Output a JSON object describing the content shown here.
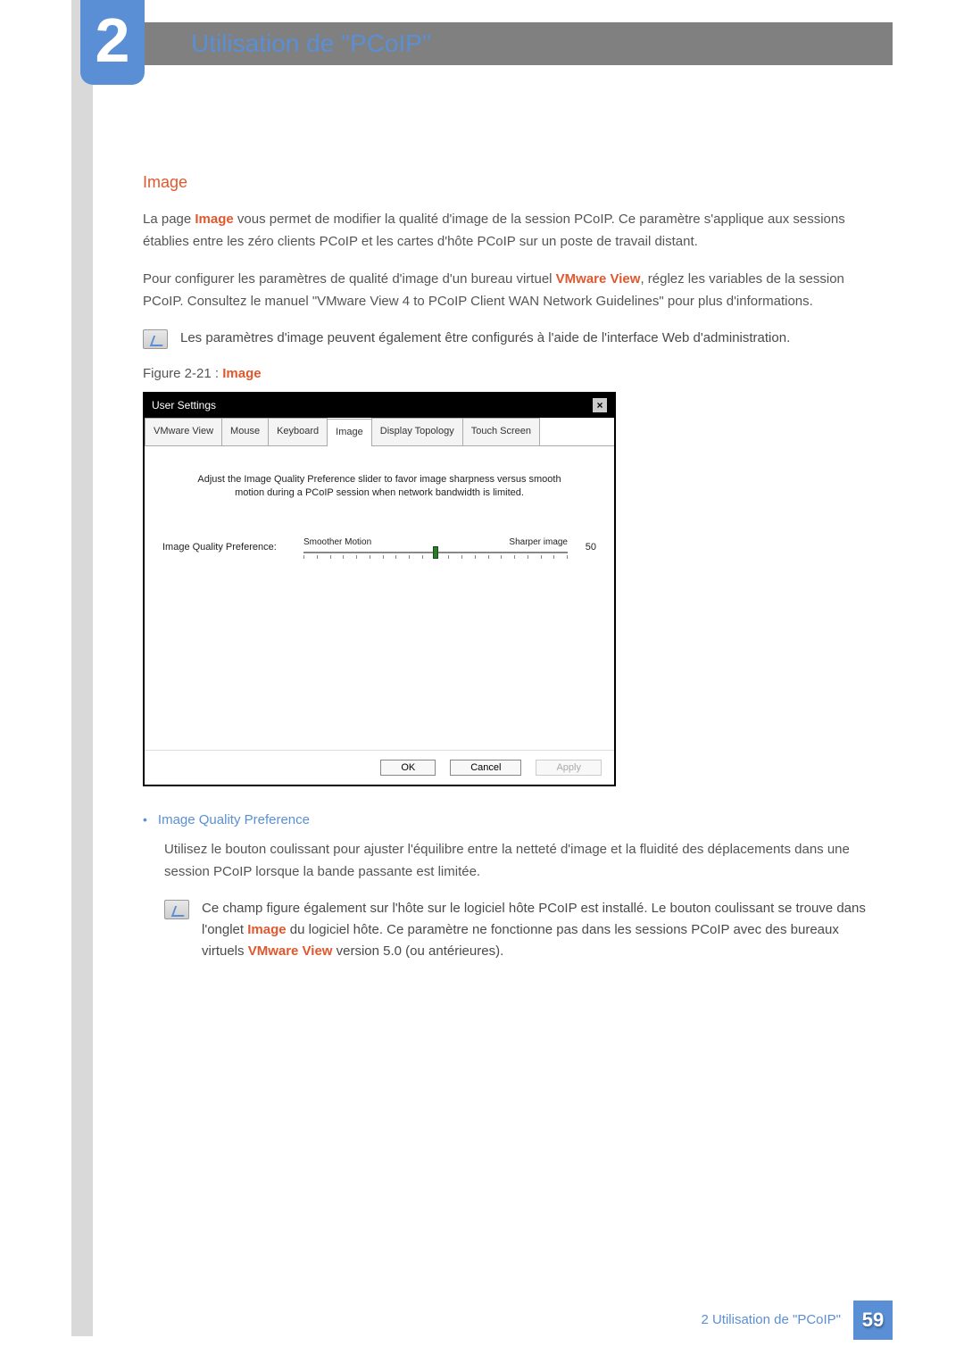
{
  "chapter": {
    "number": "2",
    "title": "Utilisation de \"PCoIP\""
  },
  "section": {
    "heading": "Image",
    "para1_a": "La page ",
    "para1_b": "Image",
    "para1_c": " vous permet de modifier la qualité d'image de la session PCoIP. Ce paramètre s'applique aux sessions établies entre les zéro clients PCoIP et les cartes d'hôte PCoIP sur un poste de travail distant.",
    "para2_a": "Pour configurer les paramètres de qualité d'image d'un bureau virtuel ",
    "para2_b": "VMware View",
    "para2_c": ", réglez les variables de la session PCoIP. Consultez le manuel \"VMware View 4 to PCoIP Client WAN Network Guidelines\" pour plus d'informations.",
    "note1": "Les paramètres d'image peuvent également être configurés à l'aide de l'interface Web d'administration.",
    "figcap_a": "Figure 2-21 : ",
    "figcap_b": "Image"
  },
  "dialog": {
    "title": "User Settings",
    "tabs": [
      "VMware View",
      "Mouse",
      "Keyboard",
      "Image",
      "Display Topology",
      "Touch Screen"
    ],
    "active_tab_index": 3,
    "instruction": "Adjust the Image Quality Preference slider to favor image sharpness versus smooth motion during a PCoIP session when network bandwidth is limited.",
    "slider_label": "Image Quality Preference:",
    "slider_left": "Smoother Motion",
    "slider_right": "Sharper image",
    "slider_value": "50",
    "btn_ok": "OK",
    "btn_cancel": "Cancel",
    "btn_apply": "Apply"
  },
  "bullet": {
    "title": "Image Quality Preference",
    "body": "Utilisez le bouton coulissant pour ajuster l'équilibre entre la netteté d'image et la fluidité des déplacements dans une session PCoIP lorsque la bande passante est limitée.",
    "note_a": "Ce champ figure également sur l'hôte sur le logiciel hôte PCoIP est installé. Le bouton coulissant se trouve dans l'onglet ",
    "note_b": "Image",
    "note_c": " du logiciel hôte. Ce paramètre ne fonctionne pas dans les sessions PCoIP avec des bureaux virtuels ",
    "note_d": "VMware View",
    "note_e": " version 5.0 (ou antérieures)."
  },
  "footer": {
    "text": "2 Utilisation de \"PCoIP\"",
    "page": "59"
  }
}
